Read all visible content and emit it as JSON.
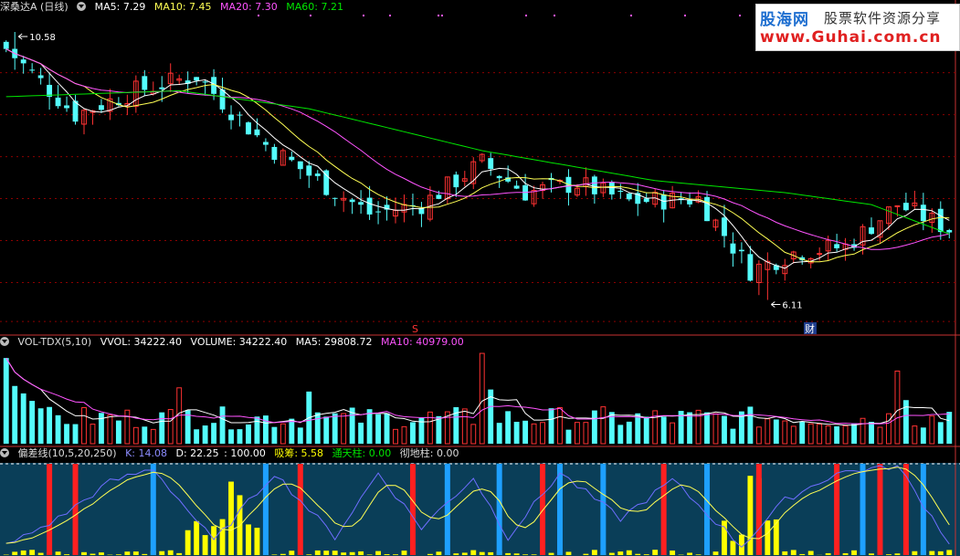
{
  "colors": {
    "up": "#ff3232",
    "down": "#54fcfc",
    "ma5": "#ffffff",
    "ma10": "#ffff54",
    "ma20": "#ff54ff",
    "ma60": "#00e600",
    "k": "#6e6eff",
    "d": "#ffff54",
    "xichou": "#ffff00",
    "tongtian": "#ff2020",
    "chedi": "#1ea0ff",
    "kdj_bg": "#0a3e58",
    "grid": "#8b0000"
  },
  "header_main": {
    "title": "深桑达A (日线)",
    "ma5": "MA5: 7.29",
    "ma10": "MA10: 7.45",
    "ma20": "MA20: 7.30",
    "ma60": "MA60: 7.21"
  },
  "header_vol": {
    "title": "VOL-TDX(5,10)",
    "vvol": "VVOL: 34222.40",
    "volume": "VOLUME: 34222.40",
    "ma5": "MA5: 29808.72",
    "ma10": "MA10: 40979.00"
  },
  "header_ind": {
    "title": "偏差线(10,5,20,250)",
    "k": "K: 14.08",
    "d": "D: 22.25",
    "c": ": 100.00",
    "xichou": "吸筹: 5.58",
    "tongtian": "通天柱: 0.00",
    "chedi": "彻地柱: 0.00"
  },
  "annotations": {
    "high": "10.58",
    "low": "6.11",
    "fin_marker": "财",
    "s_marker": "S"
  },
  "watermark": {
    "brand": "股海网",
    "tagline": "股票软件资源分享",
    "url": "www.Guhai.com.cn"
  },
  "chart_data": [
    {
      "type": "candlestick",
      "title": "深桑达A (日线)",
      "price_range": [
        5.6,
        10.9
      ],
      "max_price": 10.58,
      "min_price": 6.11,
      "candle_count": 110,
      "key_closes": [
        {
          "i": 0,
          "price": 10.3
        },
        {
          "i": 8,
          "price": 9.2
        },
        {
          "i": 15,
          "price": 9.6
        },
        {
          "i": 22,
          "price": 9.85
        },
        {
          "i": 30,
          "price": 8.7
        },
        {
          "i": 36,
          "price": 8.1
        },
        {
          "i": 42,
          "price": 7.55
        },
        {
          "i": 48,
          "price": 7.7
        },
        {
          "i": 55,
          "price": 8.4
        },
        {
          "i": 60,
          "price": 7.9
        },
        {
          "i": 66,
          "price": 8.05
        },
        {
          "i": 72,
          "price": 7.75
        },
        {
          "i": 80,
          "price": 7.8
        },
        {
          "i": 86,
          "price": 6.6
        },
        {
          "i": 91,
          "price": 6.9
        },
        {
          "i": 97,
          "price": 7.0
        },
        {
          "i": 103,
          "price": 7.7
        },
        {
          "i": 109,
          "price": 7.29
        }
      ],
      "ma_last": {
        "MA5": 7.29,
        "MA10": 7.45,
        "MA20": 7.3,
        "MA60": 7.21
      }
    },
    {
      "type": "bar",
      "title": "VOL-TDX(5,10)",
      "last": {
        "VVOL": 34222.4,
        "VOLUME": 34222.4,
        "MA5": 29808.72,
        "MA10": 40979.0
      },
      "y_range": [
        0,
        100000
      ],
      "peaks": [
        {
          "i": 0,
          "value": 92000
        },
        {
          "i": 20,
          "value": 60000
        },
        {
          "i": 35,
          "value": 56000
        },
        {
          "i": 55,
          "value": 97000
        },
        {
          "i": 103,
          "value": 78000
        }
      ]
    },
    {
      "type": "line",
      "title": "偏差线(10,5,20,250)",
      "y_range": [
        0,
        100
      ],
      "last": {
        "K": 14.08,
        "D": 22.25,
        "吸筹": 5.58,
        "通天柱": 0.0,
        "彻地柱": 0.0
      },
      "tongtian_bars_at": [
        5,
        8,
        34,
        47,
        62,
        76,
        87,
        96,
        101,
        104
      ],
      "chedi_bars_at": [
        17,
        30,
        51,
        57,
        64,
        69,
        81,
        99,
        106
      ],
      "k_key": [
        {
          "i": 0,
          "v": 10
        },
        {
          "i": 6,
          "v": 40
        },
        {
          "i": 12,
          "v": 80
        },
        {
          "i": 17,
          "v": 95
        },
        {
          "i": 24,
          "v": 15
        },
        {
          "i": 31,
          "v": 90
        },
        {
          "i": 38,
          "v": 20
        },
        {
          "i": 43,
          "v": 90
        },
        {
          "i": 48,
          "v": 30
        },
        {
          "i": 54,
          "v": 85
        },
        {
          "i": 58,
          "v": 20
        },
        {
          "i": 64,
          "v": 90
        },
        {
          "i": 71,
          "v": 40
        },
        {
          "i": 77,
          "v": 82
        },
        {
          "i": 85,
          "v": 10
        },
        {
          "i": 90,
          "v": 60
        },
        {
          "i": 96,
          "v": 90
        },
        {
          "i": 103,
          "v": 98
        },
        {
          "i": 109,
          "v": 14
        }
      ]
    }
  ]
}
